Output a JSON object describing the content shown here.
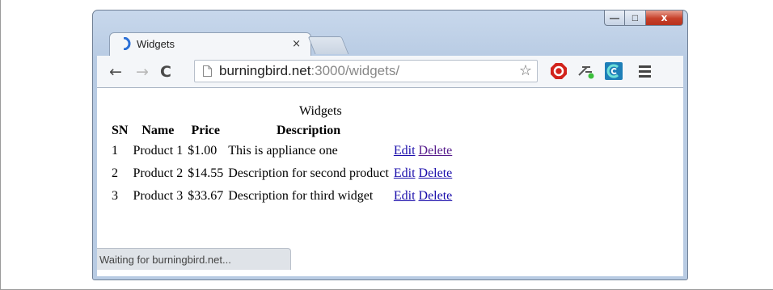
{
  "window": {
    "controls": {
      "minimize": "—",
      "maximize": "□",
      "close": "x"
    }
  },
  "tab": {
    "title": "Widgets",
    "close": "×"
  },
  "toolbar": {
    "back": "←",
    "forward": "→",
    "reload": "C",
    "url_host": "burningbird.net",
    "url_rest": ":3000/widgets/",
    "star": "☆"
  },
  "page": {
    "caption": "Widgets",
    "columns": [
      "SN",
      "Name",
      "Price",
      "Description"
    ],
    "rows": [
      {
        "sn": "1",
        "name": "Product 1",
        "price": "$1.00",
        "description": "This is appliance one",
        "edit": "Edit",
        "delete": "Delete"
      },
      {
        "sn": "2",
        "name": "Product 2",
        "price": "$14.55",
        "description": "Description for second product",
        "edit": "Edit",
        "delete": "Delete"
      },
      {
        "sn": "3",
        "name": "Product 3",
        "price": "$33.67",
        "description": "Description for third widget",
        "edit": "Edit",
        "delete": "Delete"
      }
    ]
  },
  "status": "Waiting for burningbird.net...",
  "colors": {
    "link": "#1a0dab",
    "visited_link": "#551a8b",
    "close_button": "#c7402a"
  }
}
